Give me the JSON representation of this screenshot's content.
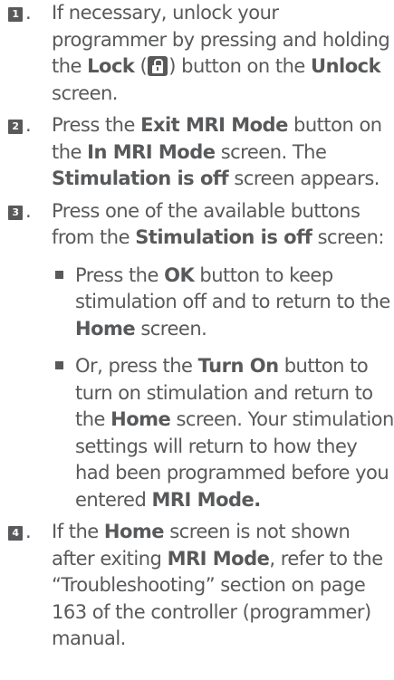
{
  "steps": [
    {
      "number": "1",
      "t1": "If necessary, unlock your programmer by pressing and holding the ",
      "b1": "Lock",
      "t2": " (",
      "lock_icon": "lock-icon",
      "t3": ") button on the ",
      "b2": "Unlock",
      "t4": " screen."
    },
    {
      "number": "2",
      "t1": "Press the ",
      "b1": "Exit MRI Mode",
      "t2": " button on the ",
      "b2": "In MRI Mode",
      "t3": " screen. The ",
      "b3": "Stimulation is off",
      "t4": " screen appears."
    },
    {
      "number": "3",
      "t1": "Press one of the available buttons from the ",
      "b1": "Stimulation is off",
      "t2": " screen:",
      "bullets": [
        {
          "t1": "Press the ",
          "b1": "OK",
          "t2": " button to keep stimulation off and to return to the ",
          "b2": "Home",
          "t3": " screen."
        },
        {
          "t1": "Or, press the ",
          "b1": "Turn On",
          "t2": " button to turn on stimulation and return to the ",
          "b2": "Home",
          "t3": " screen. Your stimulation settings will return to how they had been programmed before you entered ",
          "b3": "MRI Mode."
        }
      ]
    },
    {
      "number": "4",
      "t1": "If the ",
      "b1": "Home",
      "t2": " screen is not shown after exiting ",
      "b2": "MRI Mode",
      "t3": ", refer to the “Troubleshooting” section on page 163 of the controller (programmer) manual."
    }
  ]
}
